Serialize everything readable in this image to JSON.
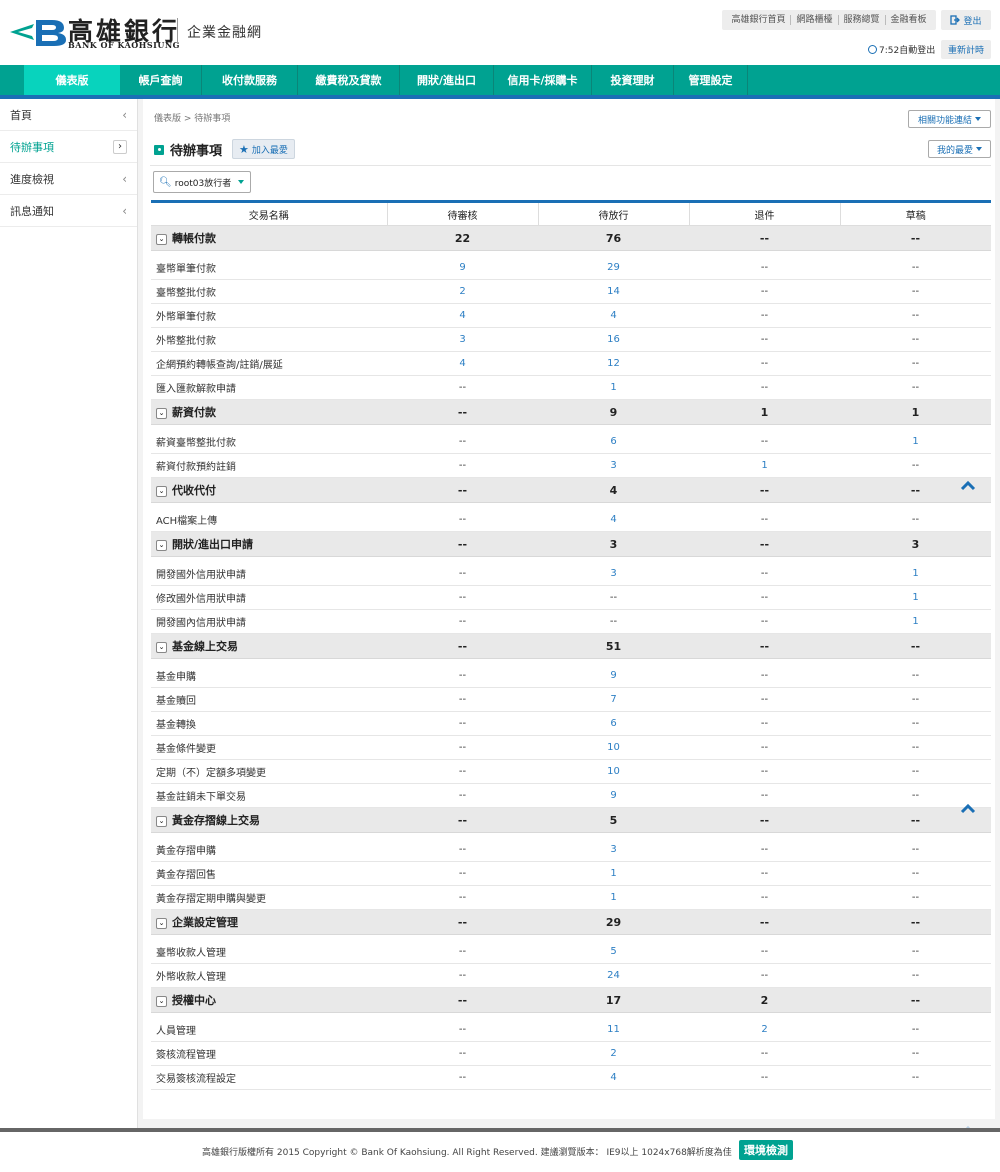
{
  "header": {
    "bank_name": "高雄銀行",
    "bank_en": "BANK OF KAOHSIUNG",
    "site_name": "企業金融網",
    "top_links": [
      "高雄銀行首頁",
      "網路櫃檯",
      "服務總覽",
      "金融看板"
    ],
    "logout": "登出",
    "timer": "7:52自動登出",
    "renew": "重新計時",
    "colors": {
      "brand": "#00a291",
      "accent": "#1a6fb5"
    }
  },
  "nav": {
    "items": [
      "儀表版",
      "帳戶查詢",
      "收付款服務",
      "繳費稅及貸款",
      "開狀/進出口",
      "信用卡/採購卡",
      "投資理財",
      "管理設定"
    ],
    "active": "儀表版"
  },
  "sidebar": {
    "items": [
      {
        "label": "首頁"
      },
      {
        "label": "待辦事項"
      },
      {
        "label": "進度檢視"
      },
      {
        "label": "訊息通知"
      }
    ]
  },
  "page": {
    "breadcrumb": "儀表版 > 待辦事項",
    "related_btn": "相關功能連結",
    "fav_btn": "我的最愛",
    "title": "待辦事項",
    "add_fav": "加入最愛",
    "account_select": "root03放行者"
  },
  "table": {
    "headers": [
      "交易名稱",
      "待審核",
      "待放行",
      "退件",
      "草稿"
    ],
    "groups": [
      {
        "name": "轉帳付款",
        "totals": [
          "22",
          "76",
          "--",
          "--"
        ],
        "rows": [
          [
            "臺幣單筆付款",
            "9",
            "29",
            "--",
            "--"
          ],
          [
            "臺幣整批付款",
            "2",
            "14",
            "--",
            "--"
          ],
          [
            "外幣單筆付款",
            "4",
            "4",
            "--",
            "--"
          ],
          [
            "外幣整批付款",
            "3",
            "16",
            "--",
            "--"
          ],
          [
            "企網預約轉帳查詢/註銷/展延",
            "4",
            "12",
            "--",
            "--"
          ],
          [
            "匯入匯款解款申請",
            "--",
            "1",
            "--",
            "--"
          ]
        ]
      },
      {
        "name": "薪資付款",
        "totals": [
          "--",
          "9",
          "1",
          "1"
        ],
        "rows": [
          [
            "薪資臺幣整批付款",
            "--",
            "6",
            "--",
            "1"
          ],
          [
            "薪資付款預約註銷",
            "--",
            "3",
            "1",
            "--"
          ]
        ]
      },
      {
        "name": "代收代付",
        "totals": [
          "--",
          "4",
          "--",
          "--"
        ],
        "rows": [
          [
            "ACH檔案上傳",
            "--",
            "4",
            "--",
            "--"
          ]
        ]
      },
      {
        "name": "開狀/進出口申請",
        "totals": [
          "--",
          "3",
          "--",
          "3"
        ],
        "rows": [
          [
            "開發國外信用狀申請",
            "--",
            "3",
            "--",
            "1"
          ],
          [
            "修改國外信用狀申請",
            "--",
            "--",
            "--",
            "1"
          ],
          [
            "開發國內信用狀申請",
            "--",
            "--",
            "--",
            "1"
          ]
        ]
      },
      {
        "name": "基金線上交易",
        "totals": [
          "--",
          "51",
          "--",
          "--"
        ],
        "rows": [
          [
            "基金申購",
            "--",
            "9",
            "--",
            "--"
          ],
          [
            "基金贖回",
            "--",
            "7",
            "--",
            "--"
          ],
          [
            "基金轉換",
            "--",
            "6",
            "--",
            "--"
          ],
          [
            "基金條件變更",
            "--",
            "10",
            "--",
            "--"
          ],
          [
            "定期（不）定額多項變更",
            "--",
            "10",
            "--",
            "--"
          ],
          [
            "基金註銷未下單交易",
            "--",
            "9",
            "--",
            "--"
          ]
        ]
      },
      {
        "name": "黃金存摺線上交易",
        "totals": [
          "--",
          "5",
          "--",
          "--"
        ],
        "rows": [
          [
            "黃金存摺申購",
            "--",
            "3",
            "--",
            "--"
          ],
          [
            "黃金存摺回售",
            "--",
            "1",
            "--",
            "--"
          ],
          [
            "黃金存摺定期申購與變更",
            "--",
            "1",
            "--",
            "--"
          ]
        ]
      },
      {
        "name": "企業設定管理",
        "totals": [
          "--",
          "29",
          "--",
          "--"
        ],
        "rows": [
          [
            "臺幣收款人管理",
            "--",
            "5",
            "--",
            "--"
          ],
          [
            "外幣收款人管理",
            "--",
            "24",
            "--",
            "--"
          ]
        ]
      },
      {
        "name": "授權中心",
        "totals": [
          "--",
          "17",
          "2",
          "--"
        ],
        "rows": [
          [
            "人員管理",
            "--",
            "11",
            "2",
            "--"
          ],
          [
            "簽核流程管理",
            "--",
            "2",
            "--",
            "--"
          ],
          [
            "交易簽核流程設定",
            "--",
            "4",
            "--",
            "--"
          ]
        ]
      }
    ]
  },
  "footer": {
    "text": "高雄銀行版權所有 2015 Copyright © Bank Of Kaohsiung. All Right Reserved. 建議瀏覽版本： IE9以上 1024x768解析度為佳",
    "env_btn": "環境檢測"
  }
}
